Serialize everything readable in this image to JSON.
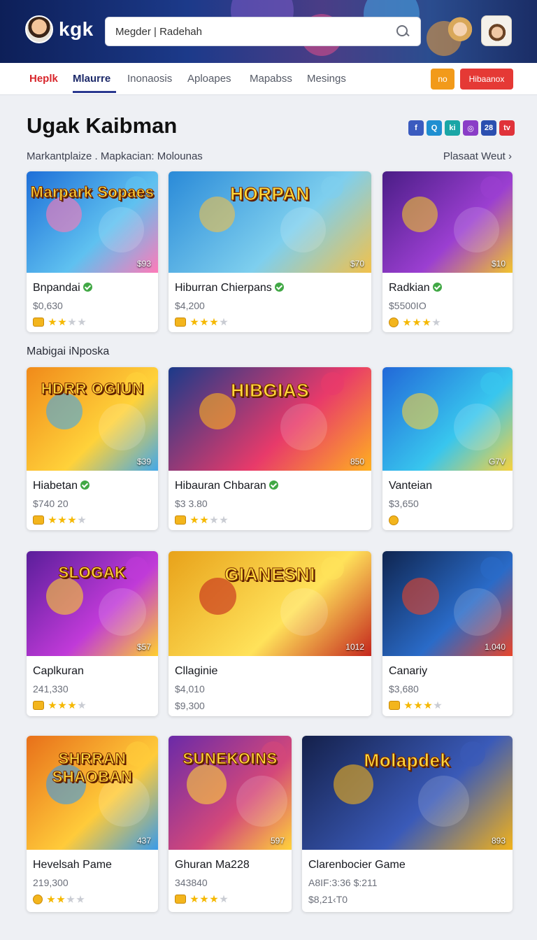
{
  "header": {
    "logo": "kgk",
    "search_value": "Megder | Radehah"
  },
  "nav": {
    "tabs": [
      "Heplk",
      "Mlaurre",
      "Inonaosis",
      "Aploapes",
      "Mapabss",
      "Mesings"
    ],
    "active_tab": "Mlaurre",
    "btn_small": "no",
    "btn_primary": "Hibaanox"
  },
  "page": {
    "title": "Ugak Kaibman",
    "breadcrumb": "Markantplaize . Mapkacian: Molounas",
    "see_all": "Plasaat Weut ›",
    "section_label": "Mabigai iNposka",
    "socials": [
      {
        "name": "facebook-icon",
        "glyph": "f",
        "color": "#3b5bbf"
      },
      {
        "name": "search-social-icon",
        "glyph": "Q",
        "color": "#1f8fd1"
      },
      {
        "name": "kick-icon",
        "glyph": "ki",
        "color": "#1aa6a6"
      },
      {
        "name": "instagram-icon",
        "glyph": "◎",
        "color": "#8a3dc7"
      },
      {
        "name": "social-28-icon",
        "glyph": "28",
        "color": "#2b4fb0"
      },
      {
        "name": "video-icon",
        "glyph": "tv",
        "color": "#e0333a"
      }
    ]
  },
  "cards": [
    {
      "name": "Bnpandai",
      "verified": true,
      "price": "$0,630",
      "price2": "",
      "badge": "$93",
      "thumb_title": "Marpark Sopaes",
      "rating": 2,
      "coin": "square",
      "colors": [
        "#1e6fd8",
        "#5fc1f0",
        "#ff7ab8"
      ]
    },
    {
      "name": "Hiburran Chierpans",
      "verified": true,
      "price": "$4,200",
      "price2": "",
      "badge": "$70",
      "thumb_title": "HORPAN",
      "rating": 3,
      "coin": "square",
      "colors": [
        "#2a8ad8",
        "#7ecfee",
        "#f2c14a"
      ]
    },
    {
      "name": "Radkian",
      "verified": true,
      "price": "$5500IO",
      "price2": "",
      "badge": "$10",
      "thumb_title": "",
      "rating": 3,
      "coin": "round",
      "colors": [
        "#4a1d86",
        "#9b3fd1",
        "#f2c42c"
      ]
    },
    {
      "name": "Hiabetan",
      "verified": true,
      "price": "$740 20",
      "price2": "",
      "badge": "$39",
      "thumb_title": "HDRR OGIUN",
      "rating": 3,
      "coin": "square",
      "colors": [
        "#f08a1a",
        "#ffd23a",
        "#43a8e8"
      ]
    },
    {
      "name": "Hibauran Chbaran",
      "verified": true,
      "price": "$3 3.80",
      "price2": "",
      "badge": "850",
      "thumb_title": "HIBGIAS",
      "rating": 2,
      "coin": "square",
      "colors": [
        "#1b3a8a",
        "#e83a6a",
        "#ffb020"
      ]
    },
    {
      "name": "Vanteian",
      "verified": false,
      "price": "$3,650",
      "price2": "",
      "badge": "G7V",
      "thumb_title": "",
      "rating": 0,
      "coin": "round",
      "colors": [
        "#2268d8",
        "#38c6ee",
        "#f7d23e"
      ]
    },
    {
      "name": "Caplkuran",
      "verified": false,
      "price": "241,330",
      "price2": "",
      "badge": "$57",
      "thumb_title": "SLOGAK",
      "rating": 3,
      "coin": "square",
      "colors": [
        "#5a1e9a",
        "#c03ad8",
        "#ffcf2e"
      ]
    },
    {
      "name": "Cllaginie",
      "verified": false,
      "price": "$4,010",
      "price2": "$9,300",
      "badge": "1012",
      "thumb_title": "GIANESNI",
      "rating": 0,
      "coin": "none",
      "colors": [
        "#e8a21a",
        "#ffe25a",
        "#c4261d"
      ]
    },
    {
      "name": "Canariy",
      "verified": false,
      "price": "$3,680",
      "price2": "",
      "badge": "1.040",
      "thumb_title": "",
      "rating": 3,
      "coin": "square",
      "colors": [
        "#0f2550",
        "#2a6bc8",
        "#e8452a"
      ]
    },
    {
      "name": "Hevelsah Pame",
      "verified": false,
      "price": "219,300",
      "price2": "",
      "badge": "437",
      "thumb_title": "SHRRAN SHAOBAN",
      "rating": 2,
      "coin": "round",
      "colors": [
        "#e8701a",
        "#ffcb3a",
        "#3a9be8"
      ]
    },
    {
      "name": "Ghuran Ma228",
      "verified": false,
      "price": "343840",
      "price2": "",
      "badge": "597",
      "thumb_title": "SUNEKOINS",
      "rating": 3,
      "coin": "square",
      "colors": [
        "#6a2aa8",
        "#d4487a",
        "#ffd23a"
      ]
    },
    {
      "name": "Clarenbocier Game",
      "verified": false,
      "price": "A8IF:3:36 $:211",
      "price2": "$8,21‹T0",
      "badge": "893",
      "thumb_title": "Molapdek",
      "rating": 0,
      "coin": "none",
      "colors": [
        "#14204a",
        "#3a5ab8",
        "#f2b21a"
      ]
    }
  ]
}
